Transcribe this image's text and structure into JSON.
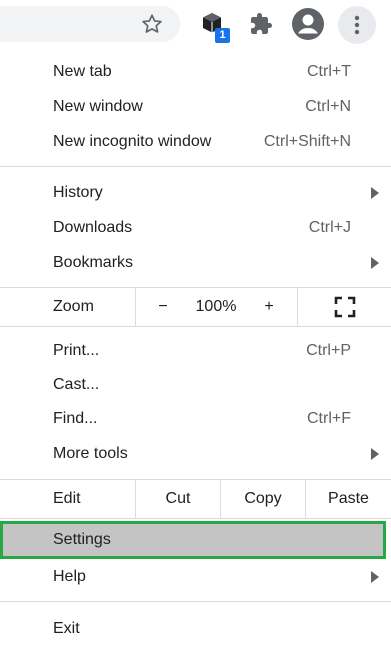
{
  "toolbar": {
    "bookmark_star": "bookmark-star",
    "extension_badge": "1",
    "accent": "#1a73e8"
  },
  "menu": {
    "new_tab": {
      "label": "New tab",
      "shortcut": "Ctrl+T"
    },
    "new_window": {
      "label": "New window",
      "shortcut": "Ctrl+N"
    },
    "new_incognito": {
      "label": "New incognito window",
      "shortcut": "Ctrl+Shift+N"
    },
    "history": {
      "label": "History"
    },
    "downloads": {
      "label": "Downloads",
      "shortcut": "Ctrl+J"
    },
    "bookmarks": {
      "label": "Bookmarks"
    },
    "zoom": {
      "label": "Zoom",
      "minus": "−",
      "value": "100%",
      "plus": "+"
    },
    "print": {
      "label": "Print...",
      "shortcut": "Ctrl+P"
    },
    "cast": {
      "label": "Cast..."
    },
    "find": {
      "label": "Find...",
      "shortcut": "Ctrl+F"
    },
    "more_tools": {
      "label": "More tools"
    },
    "edit": {
      "label": "Edit",
      "cut": "Cut",
      "copy": "Copy",
      "paste": "Paste"
    },
    "settings": {
      "label": "Settings",
      "highlight_color": "#28a745"
    },
    "help": {
      "label": "Help"
    },
    "exit": {
      "label": "Exit"
    }
  }
}
